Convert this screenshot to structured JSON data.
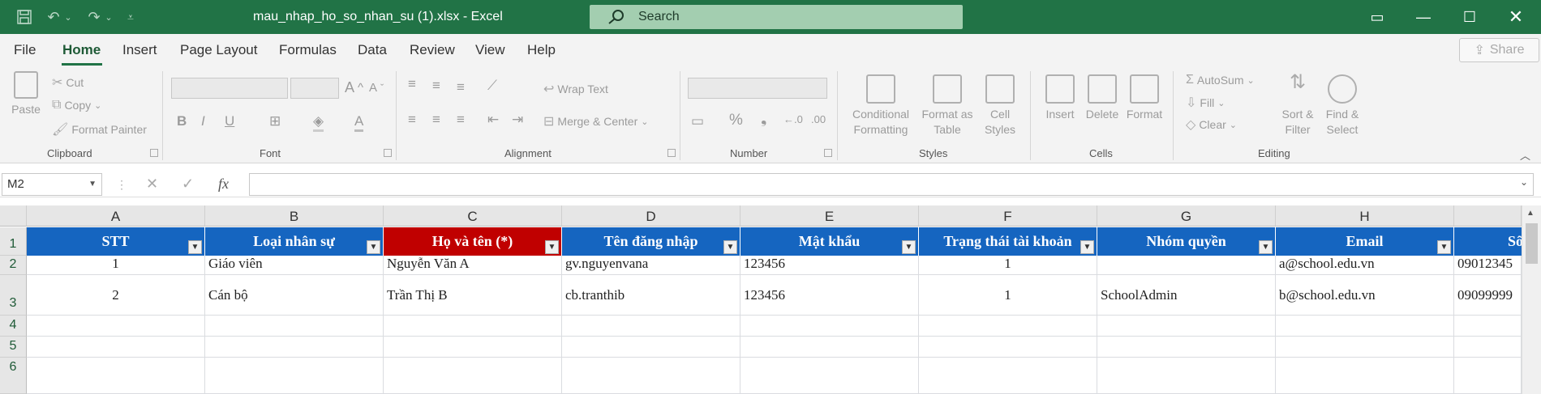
{
  "window": {
    "title": "mau_nhap_ho_so_nhan_su (1).xlsx  -  Excel",
    "search_label": "Search",
    "colors": {
      "titlebar": "#217346",
      "header_fill": "#1565c0",
      "required_header_fill": "#c00000"
    }
  },
  "menu": {
    "tabs": [
      "File",
      "Home",
      "Insert",
      "Page Layout",
      "Formulas",
      "Data",
      "Review",
      "View",
      "Help"
    ],
    "active": "Home",
    "share_label": "Share"
  },
  "ribbon": {
    "clipboard": {
      "paste": "Paste",
      "cut": "Cut",
      "copy": "Copy",
      "format_painter": "Format Painter",
      "label": "Clipboard"
    },
    "font": {
      "label": "Font"
    },
    "alignment": {
      "wrap_text": "Wrap Text",
      "merge_center": "Merge & Center",
      "label": "Alignment"
    },
    "number": {
      "label": "Number"
    },
    "styles": {
      "conditional_line1": "Conditional",
      "conditional_line2": "Formatting",
      "format_table_line1": "Format as",
      "format_table_line2": "Table",
      "cell_styles_line1": "Cell",
      "cell_styles_line2": "Styles",
      "label": "Styles"
    },
    "cells": {
      "insert": "Insert",
      "delete": "Delete",
      "format": "Format",
      "label": "Cells"
    },
    "editing": {
      "autosum": "AutoSum",
      "fill": "Fill",
      "clear": "Clear",
      "sort_line1": "Sort &",
      "sort_line2": "Filter",
      "find_line1": "Find &",
      "find_line2": "Select",
      "label": "Editing"
    }
  },
  "formula_bar": {
    "name_box": "M2",
    "fx": "fx",
    "value": ""
  },
  "sheet": {
    "columns": [
      "A",
      "B",
      "C",
      "D",
      "E",
      "F",
      "G",
      "H"
    ],
    "rows": [
      "1",
      "2",
      "3",
      "4",
      "5",
      "6"
    ],
    "headers": [
      "STT",
      "Loại nhân sự",
      "Họ và tên (*)",
      "Tên đăng nhập",
      "Mật khẩu",
      "Trạng thái tài khoản",
      "Nhóm quyền",
      "Email",
      "Số"
    ],
    "data": [
      [
        "1",
        "Giáo viên",
        "Nguyễn Văn A",
        "gv.nguyenvana",
        "123456",
        "1",
        "",
        "a@school.edu.vn",
        "09012345"
      ],
      [
        "2",
        "Cán bộ",
        "Trần Thị B",
        "cb.tranthib",
        "123456",
        "1",
        "SchoolAdmin",
        "b@school.edu.vn",
        "09099999"
      ]
    ]
  }
}
